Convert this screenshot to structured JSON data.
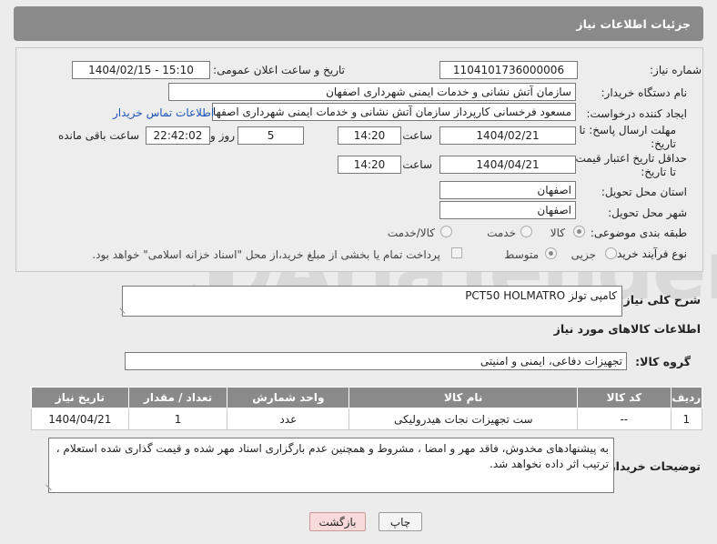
{
  "header": {
    "title": "جزئيات اطلاعات نياز"
  },
  "form": {
    "need_number_label": "شماره نیاز:",
    "need_number": "1104101736000006",
    "announce_label": "تاریخ و ساعت اعلان عمومی:",
    "announce_value": "1404/02/15 - 15:10",
    "buyer_org_label": "نام دستگاه خریدار:",
    "buyer_org": "سازمان آتش نشانی و خدمات ایمنی شهرداری اصفهان",
    "creator_label": "ایجاد کننده درخواست:",
    "creator": "مسعود فرخسانی کارپرداز سازمان آتش نشانی و خدمات ایمنی شهرداری اصفهان",
    "contact_link": "اطلاعات تماس خریدار",
    "deadline_label_1": "مهلت ارسال پاسخ: تا",
    "deadline_label_2": "تاریخ:",
    "deadline_date": "1404/02/21",
    "time_label": "ساعت",
    "deadline_time": "14:20",
    "days_value": "5",
    "days_label": "روز و",
    "remaining_time": "22:42:02",
    "remaining_label": "ساعت باقی مانده",
    "price_label_1": "حداقل تاریخ اعتبار قیمت:",
    "price_label_2": "تا تاریخ:",
    "price_date": "1404/04/21",
    "price_time": "14:20",
    "province_label": "استان محل تحویل:",
    "province": "اصفهان",
    "city_label": "شهر محل تحویل:",
    "city": "اصفهان",
    "category_label": "طبقه بندی موضوعی:",
    "category_options": [
      "کالا",
      "خدمت",
      "کالا/خدمت"
    ],
    "process_label": "نوع فرآیند خرید :",
    "process_options": [
      "جزیی",
      "متوسط"
    ],
    "payment_note": "پرداخت تمام یا بخشی از مبلغ خرید،از محل \"اسناد خزانه اسلامی\" خواهد بود."
  },
  "summary": {
    "label": "شرح کلی نیاز:",
    "value": "کامپی تولز PCT50 HOLMATRO"
  },
  "goods_section": {
    "title": "اطلاعات کالاهای مورد نیاز",
    "group_label": "گروه کالا:",
    "group_value": "تجهیزات دفاعی، ایمنی و امنیتی"
  },
  "table": {
    "headers": [
      "ردیف",
      "کد کالا",
      "نام کالا",
      "واحد شمارش",
      "تعداد / مقدار",
      "تاریخ نیاز"
    ],
    "rows": [
      [
        "1",
        "--",
        "ست تجهیزات نجات هیدرولیکی",
        "عدد",
        "1",
        "1404/04/21"
      ]
    ]
  },
  "notes": {
    "label": "توضیحات خریدار:",
    "value": "به پیشنهادهای مخدوش، فاقد مهر و امضا ، مشروط و همچنین عدم بارگزاری اسناد مهر شده و قیمت گذاری شده استعلام ، ترتیب اثر داده نخواهد شد."
  },
  "buttons": {
    "print": "چاپ",
    "back": "بازگشت"
  },
  "watermark": {
    "text": "AriaTender.neT"
  }
}
